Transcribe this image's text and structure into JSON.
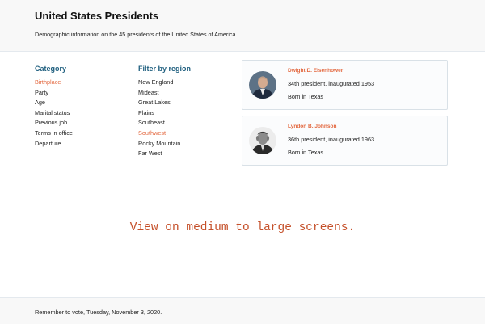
{
  "header": {
    "title": "United States Presidents",
    "subtitle": "Demographic information on the 45 presidents of the United States of America."
  },
  "category": {
    "heading": "Category",
    "items": [
      {
        "label": "Birthplace",
        "active": true
      },
      {
        "label": "Party",
        "active": false
      },
      {
        "label": "Age",
        "active": false
      },
      {
        "label": "Marital status",
        "active": false
      },
      {
        "label": "Previous job",
        "active": false
      },
      {
        "label": "Terms in office",
        "active": false
      },
      {
        "label": "Departure",
        "active": false
      }
    ]
  },
  "region": {
    "heading": "Filter by region",
    "items": [
      {
        "label": "New England",
        "active": false
      },
      {
        "label": "Mideast",
        "active": false
      },
      {
        "label": "Great Lakes",
        "active": false
      },
      {
        "label": "Plains",
        "active": false
      },
      {
        "label": "Southeast",
        "active": false
      },
      {
        "label": "Southwest",
        "active": true
      },
      {
        "label": "Rocky Mountain",
        "active": false
      },
      {
        "label": "Far West",
        "active": false
      }
    ]
  },
  "presidents": [
    {
      "name": "Dwight D. Eisenhower",
      "line1": "34th president, inaugurated 1953",
      "line2": "Born in Texas"
    },
    {
      "name": "Lyndon B. Johnson",
      "line1": "36th president, inaugurated 1963",
      "line2": "Born in Texas"
    }
  ],
  "notice": "View on medium to large screens.",
  "footer": {
    "text": "Remember to vote, Tuesday, November 3, 2020."
  },
  "colors": {
    "accent": "#e3683f",
    "heading": "#1f5f7f",
    "notice": "#c5502a"
  }
}
